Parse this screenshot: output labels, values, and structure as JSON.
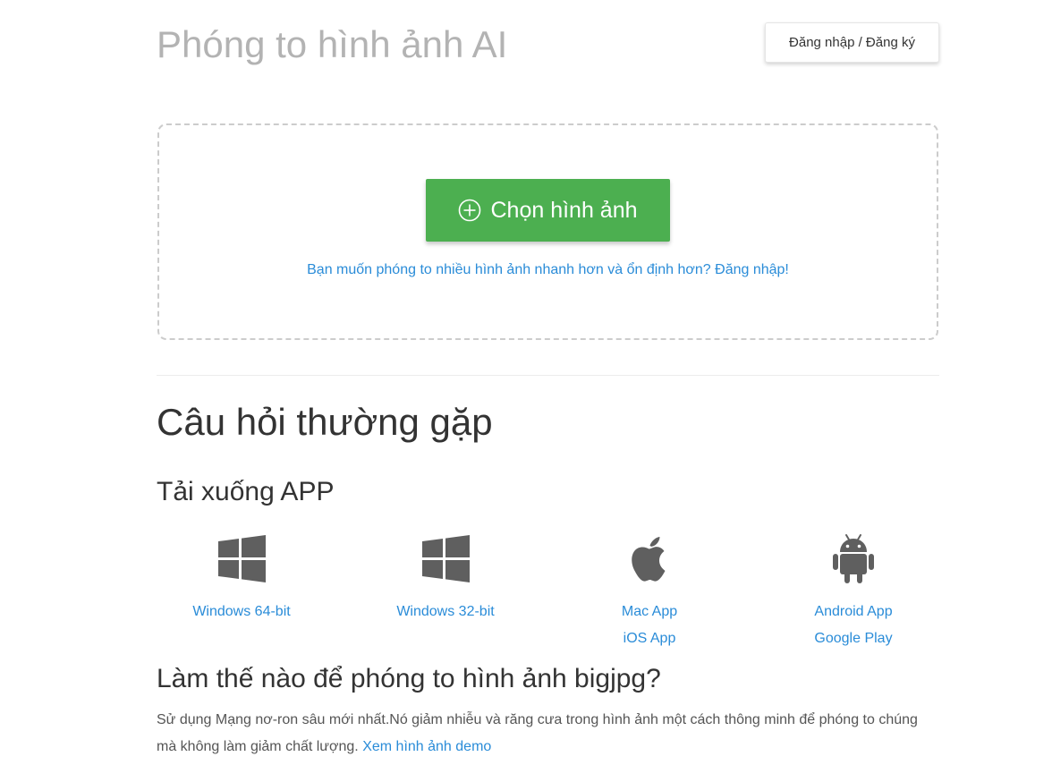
{
  "header": {
    "title": "Phóng to hình ảnh AI",
    "login_label": "Đăng nhập / Đăng ký"
  },
  "upload": {
    "button_label": "Chọn hình ảnh",
    "button_icon": "plus-circle-icon",
    "login_hint": "Bạn muốn phóng to nhiều hình ảnh nhanh hơn và ổn định hơn? Đăng nhập!"
  },
  "faq": {
    "title": "Câu hỏi thường gặp"
  },
  "download": {
    "title": "Tải xuống APP",
    "apps": [
      {
        "icon": "windows-icon",
        "links": [
          "Windows 64-bit"
        ]
      },
      {
        "icon": "windows-icon",
        "links": [
          "Windows 32-bit"
        ]
      },
      {
        "icon": "apple-icon",
        "links": [
          "Mac App",
          "iOS App"
        ]
      },
      {
        "icon": "android-icon",
        "links": [
          "Android App",
          "Google Play"
        ]
      }
    ]
  },
  "howto": {
    "title": "Làm thế nào để phóng to hình ảnh bigjpg?",
    "text": "Sử dụng Mạng nơ-ron sâu mới nhất.Nó giảm nhiễu và răng cưa trong hình ảnh một cách thông minh để phóng to chúng mà không làm giảm chất lượng.",
    "demo_link": "Xem hình ảnh demo"
  },
  "colors": {
    "accent_green": "#4caf50",
    "link_blue": "#2a8cd8",
    "icon_gray": "#5f5f5f"
  }
}
